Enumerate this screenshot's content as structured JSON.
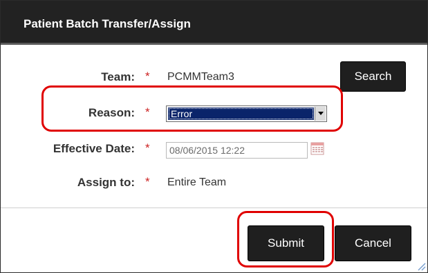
{
  "dialog": {
    "title": "Patient Batch Transfer/Assign",
    "fields": {
      "team": {
        "label": "Team:",
        "required_mark": "*",
        "value": "PCMMTeam3"
      },
      "reason": {
        "label": "Reason:",
        "required_mark": "*",
        "selected": "Error"
      },
      "effective_date": {
        "label": "Effective Date:",
        "required_mark": "*",
        "value": "08/06/2015 12:22"
      },
      "assign_to": {
        "label": "Assign to:",
        "required_mark": "*",
        "value": "Entire Team"
      }
    },
    "buttons": {
      "search": "Search",
      "submit": "Submit",
      "cancel": "Cancel"
    }
  },
  "colors": {
    "titlebar": "#222222",
    "button": "#1f1f1f",
    "required": "#cc2222",
    "highlight": "#e00000",
    "selection": "#0a246a"
  },
  "icons": [
    "calendar-icon",
    "dropdown-arrow-icon",
    "resize-grip-icon"
  ]
}
